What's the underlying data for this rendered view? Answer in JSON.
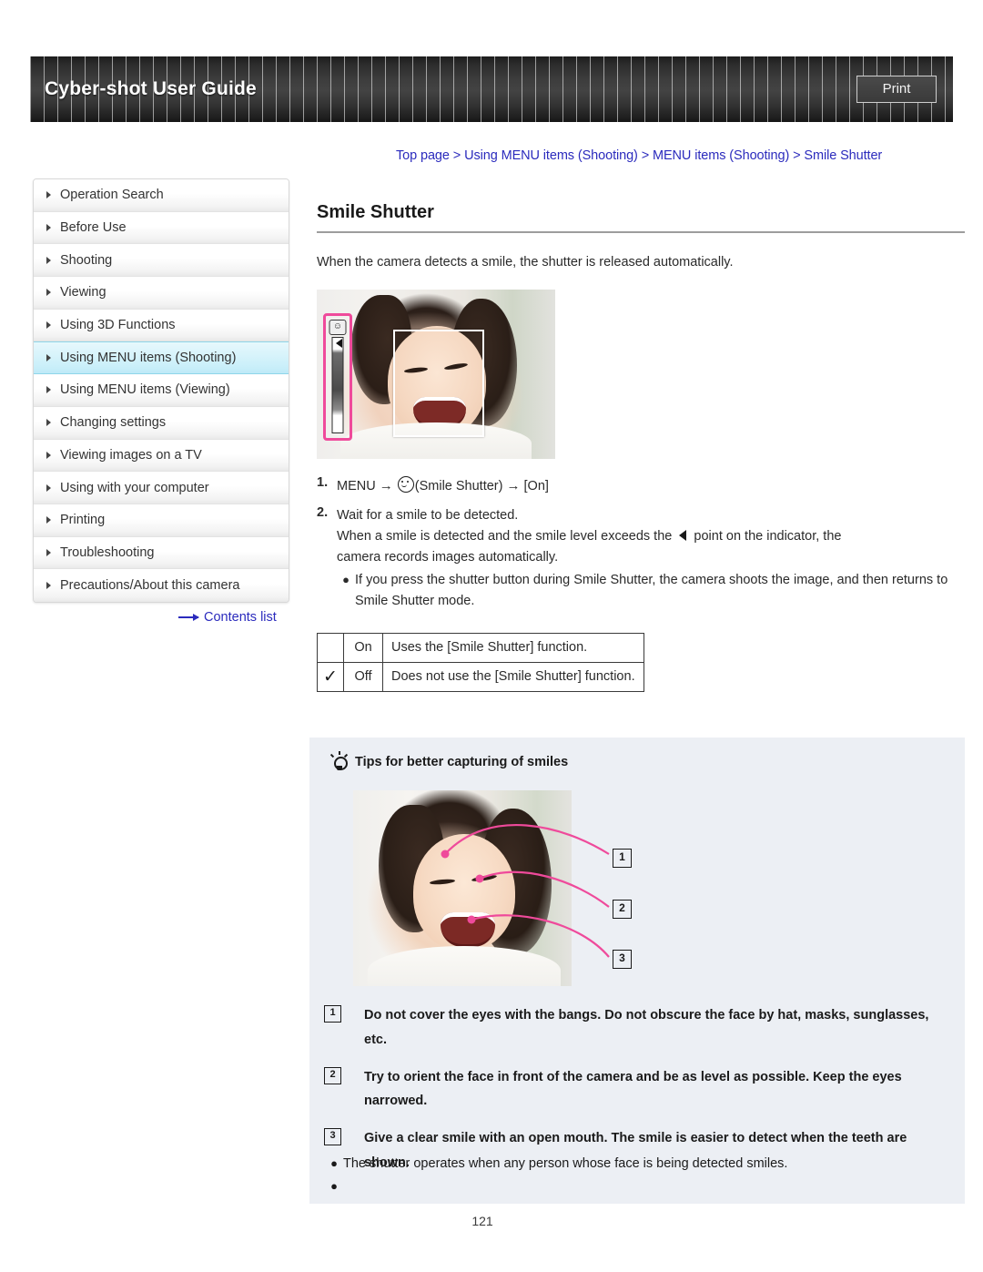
{
  "header": {
    "title": "Cyber-shot User Guide",
    "print_label": "Print"
  },
  "breadcrumb": {
    "text": "Top page > Using MENU items (Shooting) > MENU items (Shooting) > Smile Shutter"
  },
  "sidebar": {
    "items": [
      {
        "label": "Operation Search",
        "active": false
      },
      {
        "label": "Before Use",
        "active": false
      },
      {
        "label": "Shooting",
        "active": false
      },
      {
        "label": "Viewing",
        "active": false
      },
      {
        "label": "Using 3D Functions",
        "active": false
      },
      {
        "label": "Using MENU items (Shooting)",
        "active": true
      },
      {
        "label": "Using MENU items (Viewing)",
        "active": false
      },
      {
        "label": "Changing settings",
        "active": false
      },
      {
        "label": "Viewing images on a TV",
        "active": false
      },
      {
        "label": "Using with your computer",
        "active": false
      },
      {
        "label": "Printing",
        "active": false
      },
      {
        "label": "Troubleshooting",
        "active": false
      },
      {
        "label": "Precautions/About this camera",
        "active": false
      }
    ],
    "contents_link": "Contents list"
  },
  "main": {
    "title": "Smile Shutter",
    "intro": "When the camera detects a smile, the shutter is released automatically.",
    "steps": [
      {
        "number": "1.",
        "pre": "MENU",
        "arrow1": "→",
        "icon_label": "smile-shutter-icon",
        "mid": "(Smile Shutter)",
        "arrow2": "→",
        "post": "[On]"
      },
      {
        "number": "2.",
        "line1": "Wait for a smile to be detected.",
        "line2_a": "When a smile is detected and the smile level exceeds the",
        "line2_b": "point on the indicator, the",
        "line3": "camera records images automatically."
      }
    ],
    "step_bullet": "If you press the shutter button during Smile Shutter, the camera shoots the image, and then returns to Smile Shutter mode.",
    "option_table": {
      "rows": [
        {
          "checked": "",
          "option": "On",
          "description": "Uses the [Smile Shutter] function."
        },
        {
          "checked": "✓",
          "option": "Off",
          "description": "Does not use the [Smile Shutter] function."
        }
      ]
    }
  },
  "tips": {
    "heading": "Tips for better capturing of smiles",
    "callouts": [
      "1",
      "2",
      "3"
    ],
    "items": [
      {
        "number": "1",
        "text": "Do not cover the eyes with the bangs. Do not obscure the face by hat, masks, sunglasses, etc."
      },
      {
        "number": "2",
        "text": "Try to orient the face in front of the camera and be as level as possible. Keep the eyes narrowed."
      },
      {
        "number": "3",
        "text": "Give a clear smile with an open mouth. The smile is easier to detect when the teeth are shown."
      }
    ],
    "bullets": [
      "The shutter operates when any person whose face is being detected smiles.",
      ""
    ]
  },
  "footer": {
    "page_number": "121"
  },
  "colors": {
    "breadcrumb_link": "#2b2bbd",
    "sidebar_active_bg": "#cdeffa",
    "tips_panel_bg": "#eceff4",
    "callout_pink": "#ef4a9b",
    "header_dark": "#333333"
  }
}
